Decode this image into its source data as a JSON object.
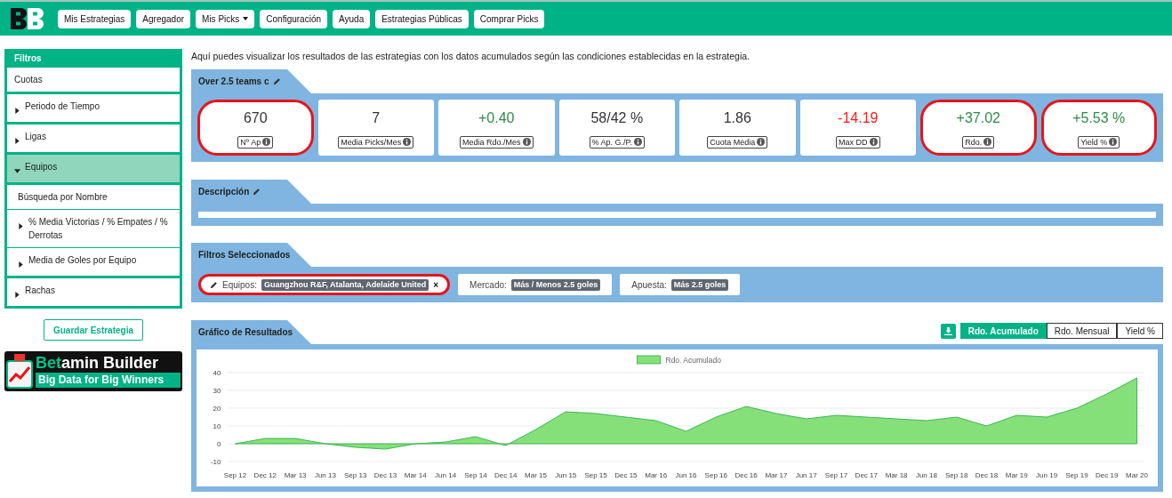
{
  "nav": [
    {
      "label": "Mis Estrategias",
      "kind": "link"
    },
    {
      "label": "Agregador",
      "kind": "link"
    },
    {
      "label": "Mis Picks",
      "kind": "dropdown"
    },
    {
      "label": "Configuración",
      "kind": "link"
    },
    {
      "label": "Ayuda",
      "kind": "link"
    },
    {
      "label": "Estrategias Públicas",
      "kind": "link"
    },
    {
      "label": "Comprar Picks",
      "kind": "link"
    }
  ],
  "sidebar": {
    "title": "Filtros",
    "items": [
      {
        "label": "Cuotas",
        "kind": "plain"
      },
      {
        "label": "Periodo de Tiempo",
        "kind": "group",
        "expanded": false
      },
      {
        "label": "Ligas",
        "kind": "group",
        "expanded": false
      },
      {
        "label": "Equipos",
        "kind": "group",
        "expanded": true,
        "children": [
          {
            "label": "Búsqueda por Nombre",
            "kind": "plain"
          },
          {
            "label": "% Media Victorias / % Empates / % Derrotas",
            "kind": "group",
            "expanded": false
          },
          {
            "label": "Media de Goles por Equipo",
            "kind": "group",
            "expanded": false
          }
        ]
      },
      {
        "label": "Rachas",
        "kind": "group",
        "expanded": false
      }
    ],
    "save_button": "Guardar Estrategia"
  },
  "banner": {
    "title_highlight": "Bet",
    "title_rest": "amin Builder",
    "tagline": "Big Data for Big Winners"
  },
  "intro": "Aquí puedes visualizar los resultados de las estrategias con los datos acumulados según las condiciones establecidas en la estrategia.",
  "strategy": {
    "title": "Over 2.5 teams c",
    "stats": [
      {
        "value": "670",
        "label": "Nº Ap",
        "color": "#333333",
        "highlighted": true
      },
      {
        "value": "7",
        "label": "Media Picks/Mes",
        "color": "#333333",
        "highlighted": false
      },
      {
        "value": "+0.40",
        "label": "Media Rdo./Mes",
        "color": "#2e8b47",
        "highlighted": false
      },
      {
        "value": "58/42 %",
        "label": "% Ap. G./P.",
        "color": "#333333",
        "highlighted": false
      },
      {
        "value": "1.86",
        "label": "Cuota Media",
        "color": "#333333",
        "highlighted": false
      },
      {
        "value": "-14.19",
        "label": "Max DD",
        "color": "#ff1a1a",
        "highlighted": false
      },
      {
        "value": "+37.02",
        "label": "Rdo.",
        "color": "#2e8b47",
        "highlighted": true
      },
      {
        "value": "+5.53 %",
        "label": "Yield %",
        "color": "#2e8b47",
        "highlighted": true
      }
    ]
  },
  "description": {
    "title": "Descripción"
  },
  "selected_filters": {
    "title": "Filtros Seleccionados",
    "chips": [
      {
        "label": "Equipos:",
        "value": "Guangzhou R&F, Atalanta, Adelaide United",
        "editable": true,
        "remove_mark": "×",
        "highlighted": true
      },
      {
        "label": "Mercado:",
        "value": "Más / Menos 2.5 goles",
        "editable": false,
        "highlighted": false
      },
      {
        "label": "Apuesta:",
        "value": "Más 2.5 goles",
        "editable": false,
        "highlighted": false
      }
    ]
  },
  "results": {
    "title": "Gráfico de Resultados",
    "views": [
      {
        "label": "Rdo. Acumulado",
        "selected": true
      },
      {
        "label": "Rdo. Mensual",
        "selected": false
      },
      {
        "label": "Yield %",
        "selected": false
      }
    ],
    "chart_data": {
      "type": "area",
      "categories": [
        "Sep 12",
        "Dec 12",
        "Mar 13",
        "Jun 13",
        "Sep 13",
        "Dec 13",
        "Mar 14",
        "Jun 14",
        "Sep 14",
        "Dec 14",
        "Mar 15",
        "Jun 15",
        "Sep 15",
        "Dec 15",
        "Mar 16",
        "Jun 16",
        "Sep 16",
        "Dec 16",
        "Mar 17",
        "Jun 17",
        "Sep 17",
        "Dec 17",
        "Mar 18",
        "Jun 18",
        "Sep 18",
        "Dec 18",
        "Mar 19",
        "Jun 19",
        "Sep 19",
        "Dec 19",
        "Mar 20"
      ],
      "series": [
        {
          "name": "Rdo. Acumulado",
          "color": "#86e07a",
          "values": [
            0,
            3,
            3,
            0,
            -2,
            -3,
            0,
            1,
            4,
            -1,
            8,
            18,
            17,
            15,
            13,
            7,
            15,
            21,
            17,
            14,
            16,
            15,
            14,
            13,
            15,
            10,
            16,
            15,
            20,
            28,
            37
          ]
        }
      ],
      "grid": true,
      "ylim": [
        -10,
        40
      ],
      "yticks": [
        -10,
        0,
        10,
        20,
        30,
        40
      ]
    }
  }
}
